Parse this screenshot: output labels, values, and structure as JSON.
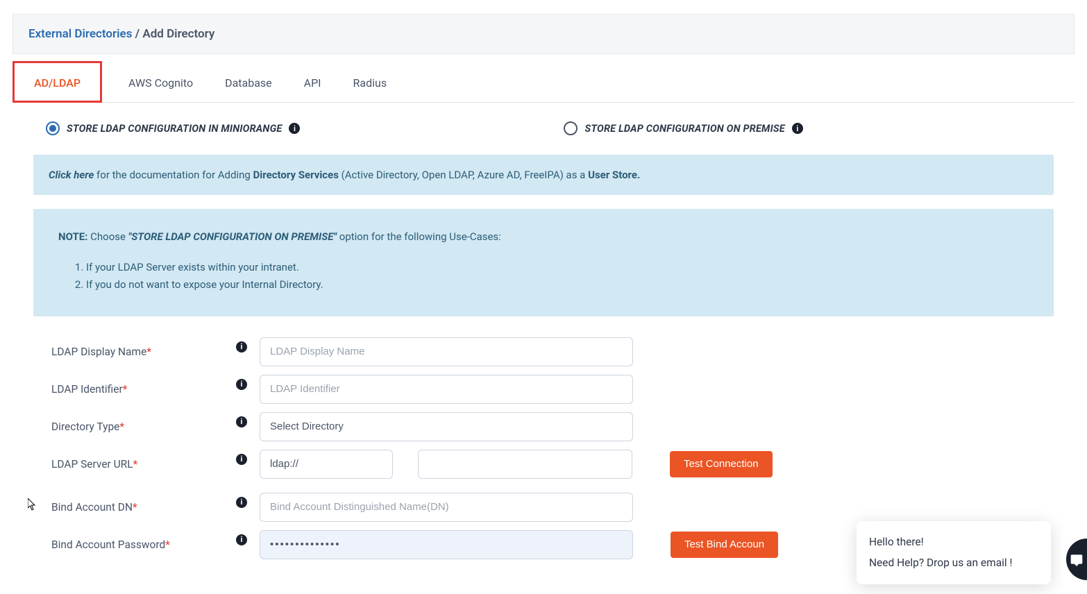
{
  "breadcrumb": {
    "link": "External Directories",
    "sep": " / ",
    "current": "Add Directory"
  },
  "tabs": [
    {
      "label": "AD/LDAP",
      "active": true
    },
    {
      "label": "AWS Cognito",
      "active": false
    },
    {
      "label": "Database",
      "active": false
    },
    {
      "label": "API",
      "active": false
    },
    {
      "label": "Radius",
      "active": false
    }
  ],
  "radios": {
    "opt1": "STORE LDAP CONFIGURATION IN MINIORANGE",
    "opt2": "STORE LDAP CONFIGURATION ON PREMISE"
  },
  "docbox": {
    "link": "Click here",
    "t1": " for the documentation for Adding ",
    "bold1": "Directory Services",
    "t2": " (Active Directory, Open LDAP, Azure AD, FreeIPA) as a ",
    "bold2": "User Store."
  },
  "notebox": {
    "label": "NOTE:",
    "t1": "  Choose ",
    "quote": "\"STORE LDAP CONFIGURATION ON PREMISE\"",
    "t2": " option for the following Use-Cases:",
    "li1": "If your LDAP Server exists within your intranet.",
    "li2": "If you do not want to expose your Internal Directory."
  },
  "form": {
    "display_name": {
      "label": "LDAP Display Name",
      "placeholder": "LDAP Display Name"
    },
    "identifier": {
      "label": "LDAP Identifier",
      "placeholder": "LDAP Identifier"
    },
    "dir_type": {
      "label": "Directory Type",
      "selected": "Select Directory"
    },
    "server_url": {
      "label": "LDAP Server URL",
      "scheme": "ldap://",
      "value": ""
    },
    "bind_dn": {
      "label": "Bind Account DN",
      "placeholder": "Bind Account Distinguished Name(DN)"
    },
    "bind_pw": {
      "label": "Bind Account Password",
      "value": "••••••••••••••"
    }
  },
  "buttons": {
    "test_connection": "Test Connection",
    "test_bind": "Test Bind Accoun"
  },
  "chat": {
    "line1": "Hello there!",
    "line2": "Need Help? Drop us an email !"
  },
  "info_glyph": "i"
}
